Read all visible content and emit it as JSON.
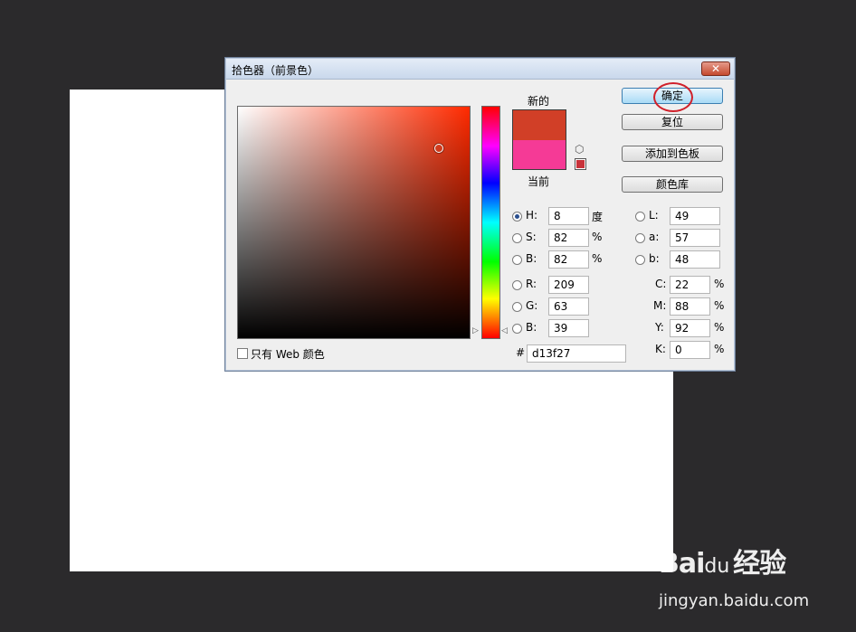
{
  "dialog": {
    "title": "拾色器（前景色）",
    "close_glyph": "✕"
  },
  "swatch": {
    "new_label": "新的",
    "current_label": "当前",
    "new_color": "#d13f27",
    "current_color": "#f53a96"
  },
  "buttons": {
    "ok": "确定",
    "reset": "复位",
    "add_to_swatches": "添加到色板",
    "color_libraries": "颜色库"
  },
  "hsb": {
    "h_label": "H:",
    "h_value": "8",
    "h_unit": "度",
    "s_label": "S:",
    "s_value": "82",
    "s_unit": "%",
    "b_label": "B:",
    "b_value": "82",
    "b_unit": "%"
  },
  "rgb": {
    "r_label": "R:",
    "r_value": "209",
    "g_label": "G:",
    "g_value": "63",
    "b_label": "B:",
    "b_value": "39"
  },
  "lab": {
    "l_label": "L:",
    "l_value": "49",
    "a_label": "a:",
    "a_value": "57",
    "b_label": "b:",
    "b_value": "48"
  },
  "cmyk": {
    "c_label": "C:",
    "c_value": "22",
    "c_unit": "%",
    "m_label": "M:",
    "m_value": "88",
    "m_unit": "%",
    "y_label": "Y:",
    "y_value": "92",
    "y_unit": "%",
    "k_label": "K:",
    "k_value": "0",
    "k_unit": "%"
  },
  "hex": {
    "label": "#",
    "value": "d13f27"
  },
  "web_only": {
    "label": "只有 Web 颜色",
    "checked": false
  },
  "icons": {
    "cube": "⬡",
    "arrow_left": "▷",
    "arrow_right": "◁"
  },
  "watermark": {
    "logo": "Bai",
    "logo_paw": "du",
    "brand": "经验",
    "url": "jingyan.baidu.com"
  },
  "colors": {
    "highlight_ring": "#d0202a",
    "background": "#2b2a2c"
  }
}
